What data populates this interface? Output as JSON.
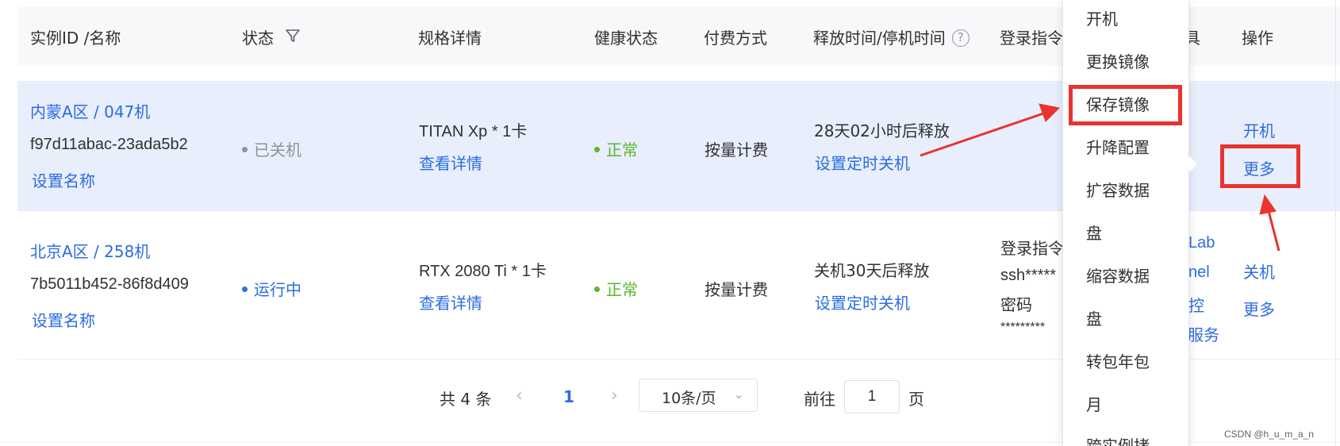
{
  "table": {
    "headers": {
      "instance": "实例ID /名称",
      "status": "状态",
      "spec": "规格详情",
      "health": "健康状态",
      "billing": "付费方式",
      "release": "释放时间/停机时间",
      "login": "登录指令",
      "tools": "具",
      "actions": "操作"
    },
    "rows": [
      {
        "region_name": "内蒙A区 / 047机",
        "instance_id": "f97d11abac-23ada5b2",
        "rename": "设置名称",
        "status": "已关机",
        "spec": "TITAN Xp * 1卡",
        "spec_detail": "查看详情",
        "health": "正常",
        "billing": "按量计费",
        "release": "28天02小时后释放",
        "schedule": "设置定时关机",
        "action_primary": "开机",
        "action_more": "更多"
      },
      {
        "region_name": "北京A区 / 258机",
        "instance_id": "7b5011b452-86f8d409",
        "rename": "设置名称",
        "status": "运行中",
        "spec": "RTX 2080 Ti * 1卡",
        "spec_detail": "查看详情",
        "health": "正常",
        "billing": "按量计费",
        "release": "关机30天后释放",
        "schedule": "设置定时关机",
        "login_cmd_label": "登录指令",
        "login_cmd_value": "ssh*****",
        "password_label": "密码",
        "password_value": "*********",
        "tools": [
          "Lab",
          "nel",
          "控",
          "服务"
        ],
        "action_primary": "关机",
        "action_more": "更多"
      }
    ]
  },
  "pagination": {
    "total": "共 4 条",
    "current_page": "1",
    "page_size": "10条/页",
    "goto_label": "前往",
    "goto_value": "1",
    "page_suffix": "页"
  },
  "dropdown_menu": {
    "items": [
      "开机",
      "更换镜像",
      "保存镜像",
      "升降配置",
      "扩容数据",
      "盘",
      "缩容数据",
      "盘",
      "转包年包",
      "月",
      "跨实例拷"
    ],
    "highlighted": "保存镜像"
  },
  "annotation_color": "#e8332f",
  "link_color": "#2b6de0",
  "healthy_color": "#5bb72c",
  "watermark": "CSDN @h_u_m_a_n"
}
